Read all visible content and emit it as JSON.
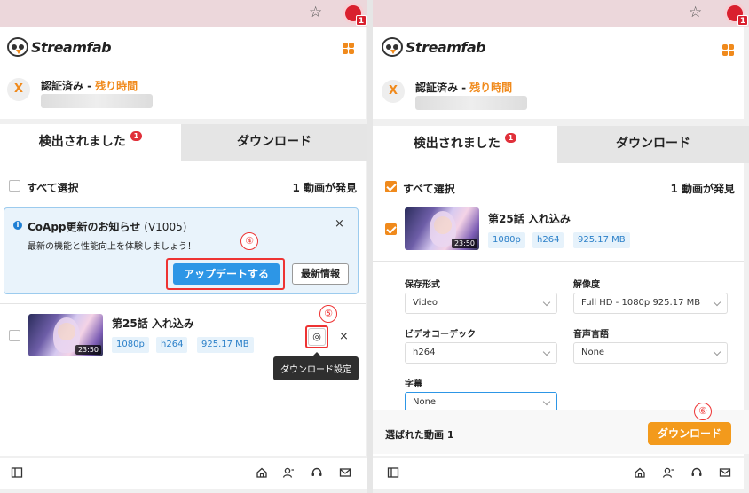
{
  "browser": {
    "star_glyph": "☆",
    "extension_badge": "1"
  },
  "header": {
    "brand": "Streamfab",
    "avatar_letter": "X",
    "auth_status": "認証済み -",
    "remaining_time_label": "残り時間"
  },
  "tabs": [
    {
      "label": "検出されました",
      "badge": "1"
    },
    {
      "label": "ダウンロード"
    }
  ],
  "select_all": {
    "label": "すべて選択"
  },
  "video_count": "1 動画が発見",
  "notice": {
    "title": "CoApp更新のお知らせ",
    "version": "(V1005)",
    "message": "最新の機能と性能向上を体験しましょう！",
    "update_button": "アップデートする",
    "news_button": "最新情報",
    "close": "×"
  },
  "video": {
    "title": "第25話 入れ込み",
    "duration": "23:50",
    "tags": [
      "1080p",
      "h264",
      "925.17 MB"
    ],
    "close": "×",
    "settings_icon": "◎"
  },
  "tooltip": "ダウンロード設定",
  "steps": {
    "four": "④",
    "five": "⑤",
    "six": "⑥"
  },
  "settings": {
    "format_label": "保存形式",
    "format_value": "Video",
    "resolution_label": "解像度",
    "resolution_value": "Full HD - 1080p 925.17 MB",
    "codec_label": "ビデオコーデック",
    "codec_value": "h264",
    "audio_label": "音声言語",
    "audio_value": "None",
    "subtitle_label": "字幕",
    "subtitle_value": "None"
  },
  "selection": {
    "text": "選ばれた動画 1",
    "download_button": "ダウンロード"
  },
  "footer_icons": [
    "sidebar-icon",
    "home-icon",
    "user-icon",
    "headset-icon",
    "mail-icon"
  ],
  "colors": {
    "accent": "#f08a1c",
    "primary": "#2d96e6",
    "highlight": "#e33333"
  }
}
